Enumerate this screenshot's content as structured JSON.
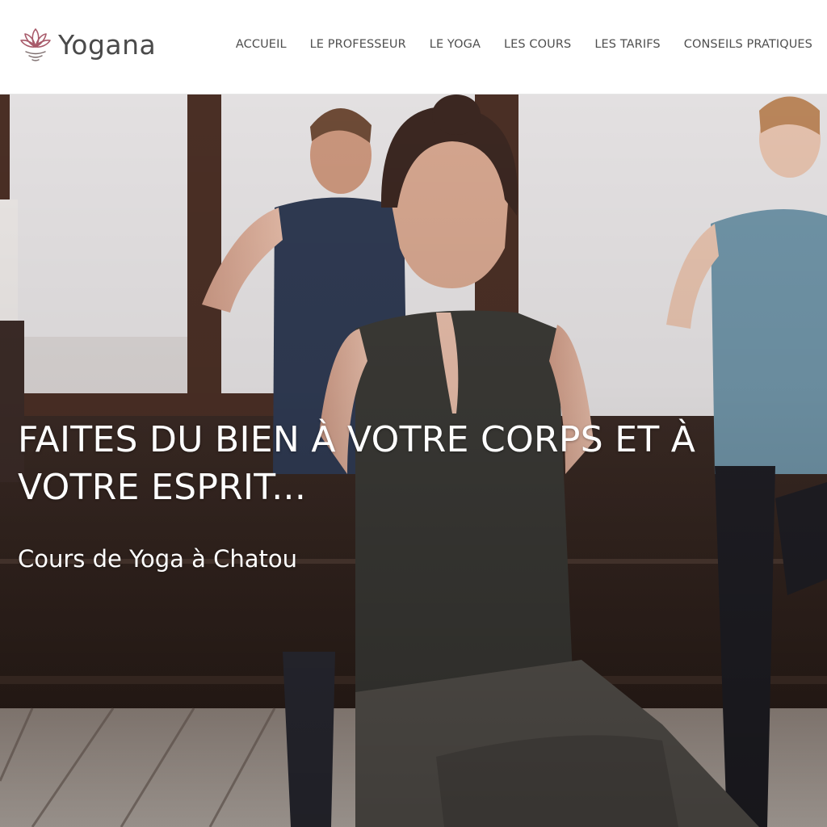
{
  "brand": {
    "name": "Yogana",
    "accent": "#a85a6a"
  },
  "nav": {
    "items": [
      {
        "label": "ACCUEIL"
      },
      {
        "label": "LE PROFESSEUR"
      },
      {
        "label": "LE YOGA"
      },
      {
        "label": "LES COURS"
      },
      {
        "label": "LES TARIFS"
      },
      {
        "label": "CONSEILS PRATIQUES"
      }
    ]
  },
  "hero": {
    "headline": "FAITES DU BIEN À VOTRE CORPS ET À VOTRE ESPRIT...",
    "subheadline": "Cours de Yoga à Chatou",
    "image": "photo of yoga class with people in prayer pose, tree position"
  }
}
